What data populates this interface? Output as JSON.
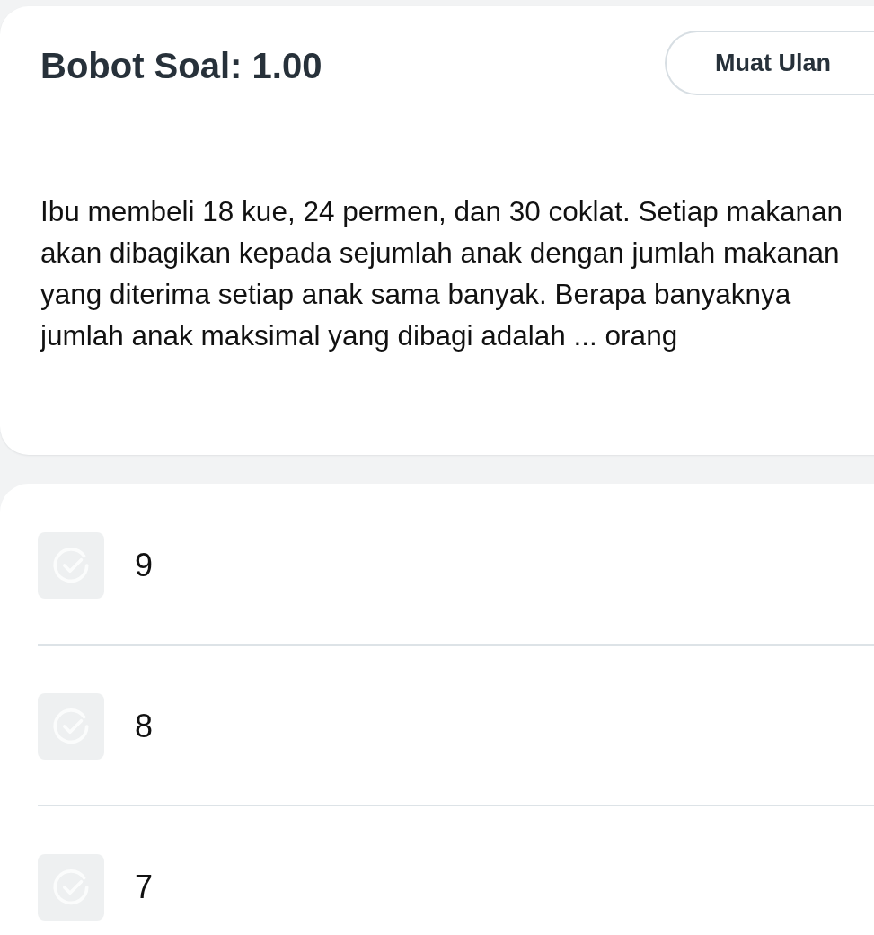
{
  "header": {
    "title": "Bobot Soal: 1.00",
    "reload_button": "Muat Ulan"
  },
  "question": "Ibu membeli 18 kue, 24 permen, dan 30 coklat. Setiap makanan akan dibagikan kepada sejumlah anak dengan jumlah makanan yang diterima setiap anak sama banyak. Berapa banyaknya jumlah anak maksimal yang dibagi adalah ... orang",
  "options": [
    {
      "label": "9",
      "selected": false
    },
    {
      "label": "8",
      "selected": false
    },
    {
      "label": "7",
      "selected": false
    }
  ]
}
